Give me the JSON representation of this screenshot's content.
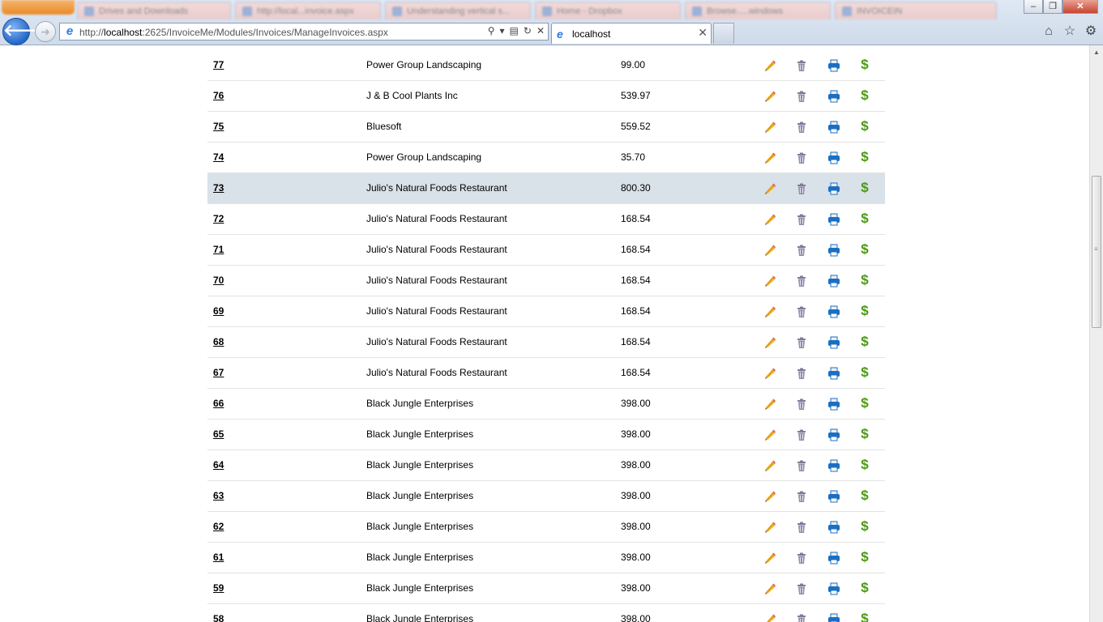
{
  "browser": {
    "url_prefix": "http://",
    "url_host": "localhost",
    "url_rest": ":2625/InvoiceMe/Modules/Invoices/ManageInvoices.aspx",
    "active_tab_title": "localhost",
    "background_tabs": [
      {
        "label": "Drives and Downloads"
      },
      {
        "label": "http://local...invoice.aspx"
      },
      {
        "label": "Understanding vertical s..."
      },
      {
        "label": "Home - Dropbox"
      },
      {
        "label": "Browse.....windows"
      },
      {
        "label": "INVOICEIN"
      }
    ],
    "icons": {
      "back": "back-arrow-icon",
      "forward": "forward-arrow-icon",
      "home": "home-icon",
      "favorites": "star-icon",
      "tools": "gear-icon"
    }
  },
  "invoices": [
    {
      "number": "77",
      "customer": "Power Group Landscaping",
      "amount": "99.00"
    },
    {
      "number": "76",
      "customer": "J & B Cool Plants Inc",
      "amount": "539.97"
    },
    {
      "number": "75",
      "customer": "Bluesoft",
      "amount": "559.52"
    },
    {
      "number": "74",
      "customer": "Power Group Landscaping",
      "amount": "35.70"
    },
    {
      "number": "73",
      "customer": "Julio's Natural Foods Restaurant",
      "amount": "800.30"
    },
    {
      "number": "72",
      "customer": "Julio's Natural Foods Restaurant",
      "amount": "168.54"
    },
    {
      "number": "71",
      "customer": "Julio's Natural Foods Restaurant",
      "amount": "168.54"
    },
    {
      "number": "70",
      "customer": "Julio's Natural Foods Restaurant",
      "amount": "168.54"
    },
    {
      "number": "69",
      "customer": "Julio's Natural Foods Restaurant",
      "amount": "168.54"
    },
    {
      "number": "68",
      "customer": "Julio's Natural Foods Restaurant",
      "amount": "168.54"
    },
    {
      "number": "67",
      "customer": "Julio's Natural Foods Restaurant",
      "amount": "168.54"
    },
    {
      "number": "66",
      "customer": "Black Jungle Enterprises",
      "amount": "398.00"
    },
    {
      "number": "65",
      "customer": "Black Jungle Enterprises",
      "amount": "398.00"
    },
    {
      "number": "64",
      "customer": "Black Jungle Enterprises",
      "amount": "398.00"
    },
    {
      "number": "63",
      "customer": "Black Jungle Enterprises",
      "amount": "398.00"
    },
    {
      "number": "62",
      "customer": "Black Jungle Enterprises",
      "amount": "398.00"
    },
    {
      "number": "61",
      "customer": "Black Jungle Enterprises",
      "amount": "398.00"
    },
    {
      "number": "59",
      "customer": "Black Jungle Enterprises",
      "amount": "398.00"
    },
    {
      "number": "58",
      "customer": "Black Jungle Enterprises",
      "amount": "398.00"
    }
  ],
  "highlighted_row": "73",
  "row_actions": {
    "edit": "pencil-icon",
    "delete": "trash-icon",
    "print": "printer-icon",
    "pay": "$"
  },
  "colors": {
    "highlight_row": "#d9e1e9",
    "pay_icon": "#4a9a12",
    "print_icon": "#1b6fc2",
    "delete_icon": "#7e7c9a",
    "edit_icon": "#e8a21a"
  }
}
